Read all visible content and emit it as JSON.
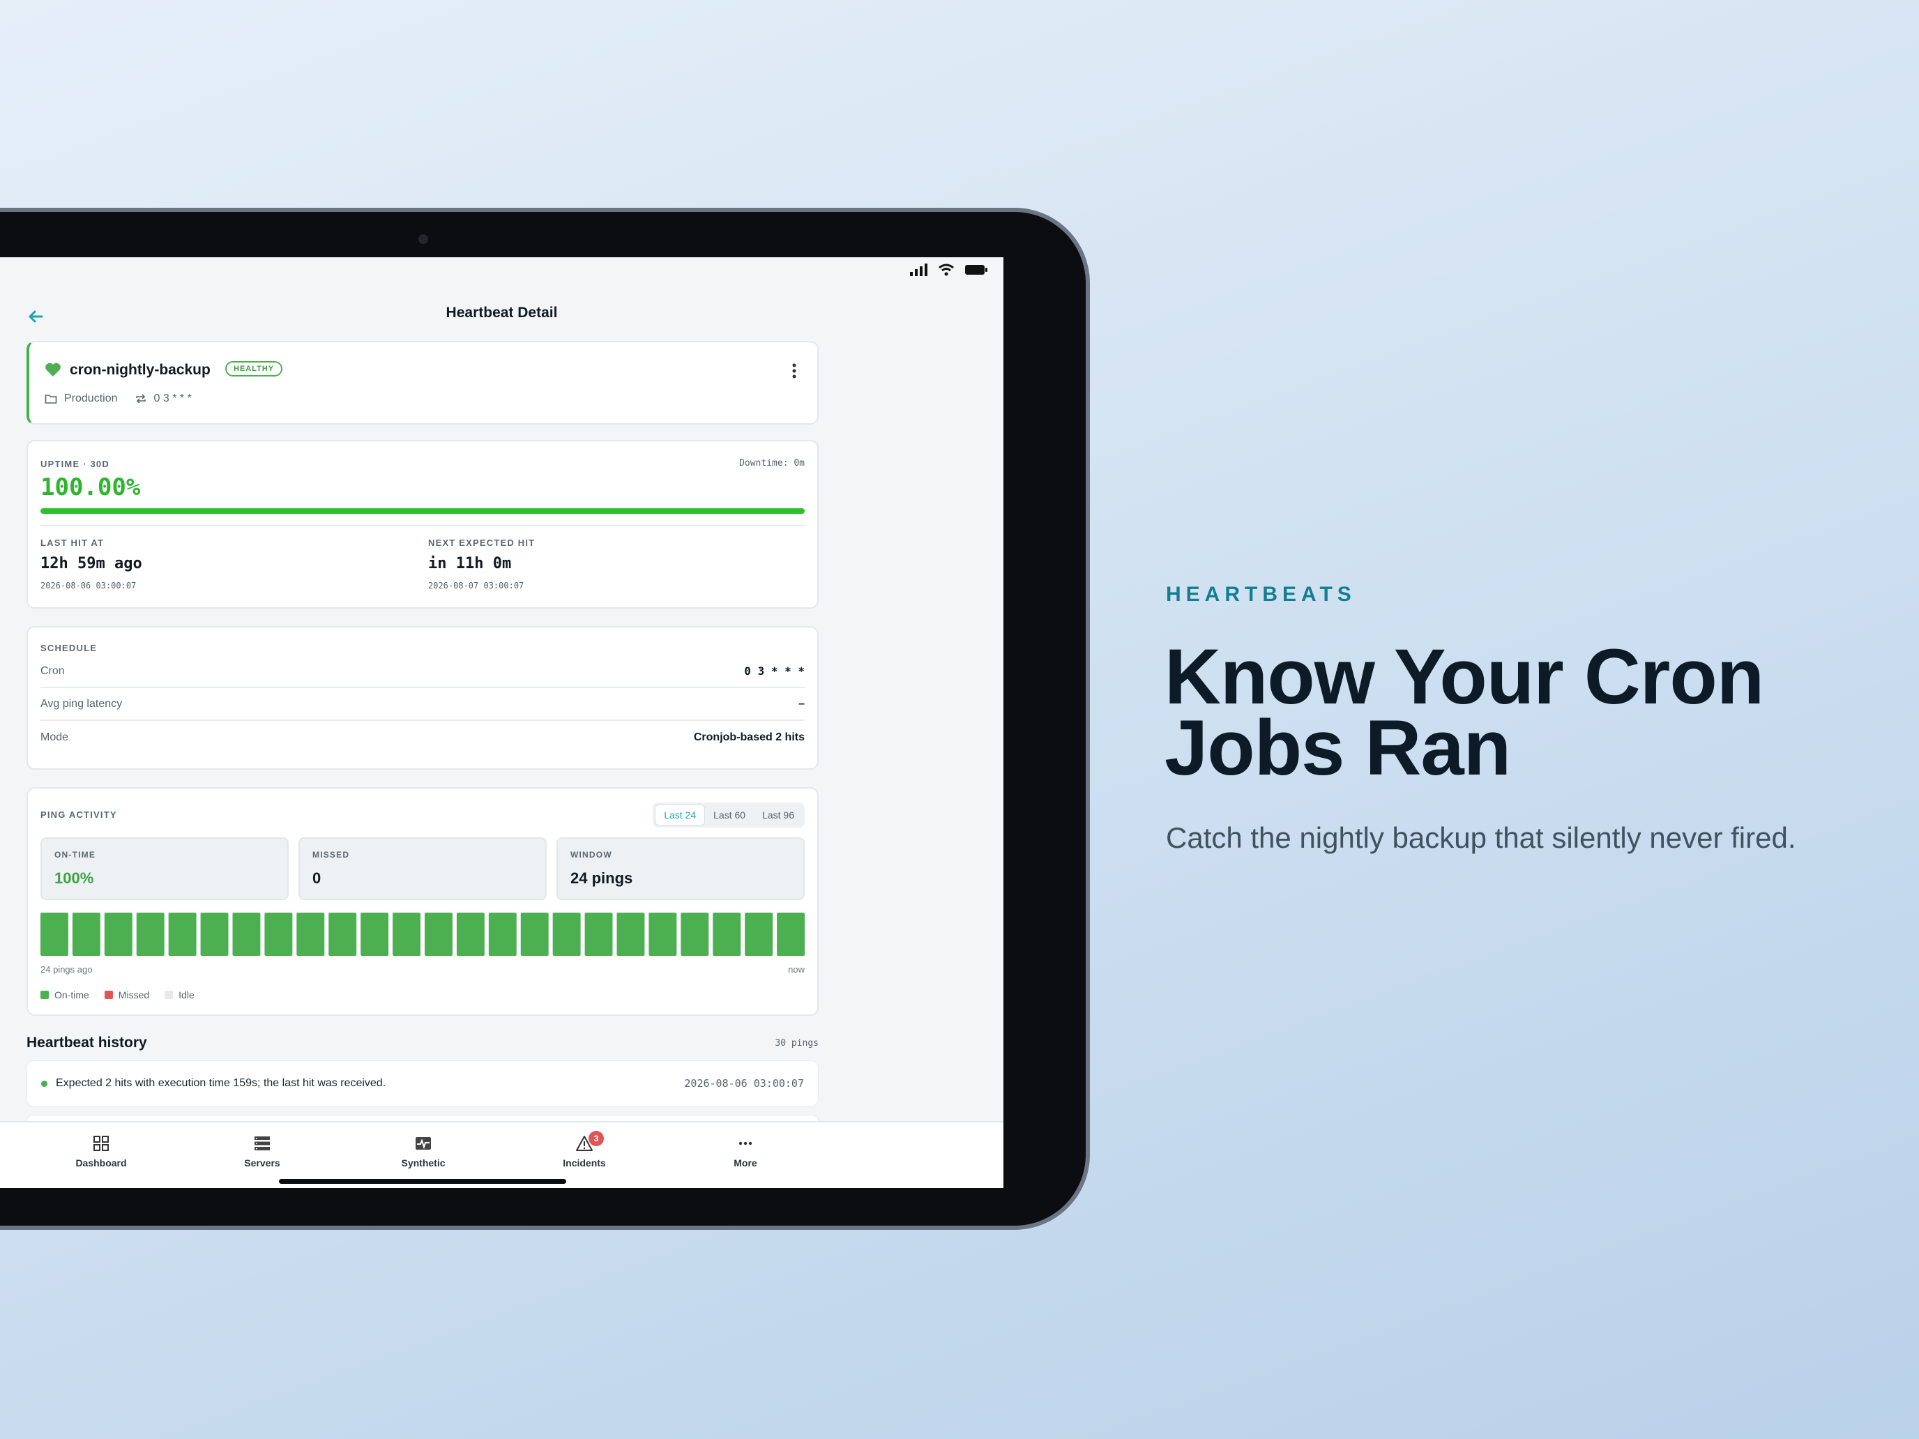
{
  "marketing": {
    "kicker": "HEARTBEATS",
    "headline": "Know Your Cron Jobs Ran",
    "subtitle": "Catch the nightly backup that silently never fired."
  },
  "header": {
    "title": "Heartbeat Detail"
  },
  "monitor": {
    "name": "cron-nightly-backup",
    "status": "HEALTHY",
    "project": "Production",
    "cron_short": "0 3 * * *"
  },
  "uptime": {
    "label": "UPTIME · 30D",
    "downtime": "Downtime: 0m",
    "percent_text": "100.00%",
    "percent_value": 100,
    "last_hit_label": "LAST HIT AT",
    "last_hit": "12h 59m ago",
    "last_hit_ts": "2026-08-06 03:00:07",
    "next_hit_label": "NEXT EXPECTED HIT",
    "next_hit": "in 11h 0m",
    "next_hit_ts": "2026-08-07 03:00:07"
  },
  "schedule": {
    "label": "SCHEDULE",
    "rows": [
      {
        "key": "Cron",
        "value": "0 3 * * *"
      },
      {
        "key": "Avg ping latency",
        "value": "–"
      },
      {
        "key": "Mode",
        "value": "Cronjob-based 2 hits"
      }
    ]
  },
  "ping_activity": {
    "label": "PING ACTIVITY",
    "ranges": [
      "Last 24",
      "Last 60",
      "Last 96"
    ],
    "active_range": 0,
    "stats": [
      {
        "label": "ON-TIME",
        "value": "100%"
      },
      {
        "label": "MISSED",
        "value": "0"
      },
      {
        "label": "WINDOW",
        "value": "24 pings"
      }
    ],
    "pings": [
      "ok",
      "ok",
      "ok",
      "ok",
      "ok",
      "ok",
      "ok",
      "ok",
      "ok",
      "ok",
      "ok",
      "ok",
      "ok",
      "ok",
      "ok",
      "ok",
      "ok",
      "ok",
      "ok",
      "ok",
      "ok",
      "ok",
      "ok",
      "ok"
    ],
    "axis_start": "24 pings ago",
    "axis_end": "now",
    "legend": [
      {
        "label": "On-time",
        "color": "#4caf50"
      },
      {
        "label": "Missed",
        "color": "#e05555"
      },
      {
        "label": "Idle",
        "color": "#e6eaee"
      }
    ]
  },
  "history": {
    "title": "Heartbeat history",
    "count": "30 pings",
    "items": [
      {
        "message": "Expected 2 hits with execution time 159s; the last hit was received.",
        "timestamp": "2026-08-06 03:00:07"
      }
    ]
  },
  "tabs": [
    {
      "label": "Dashboard",
      "icon": "grid-icon"
    },
    {
      "label": "Servers",
      "icon": "server-icon"
    },
    {
      "label": "Synthetic",
      "icon": "pulse-icon"
    },
    {
      "label": "Incidents",
      "icon": "warning-icon",
      "badge": "3"
    },
    {
      "label": "More",
      "icon": "more-icon"
    }
  ],
  "colors": {
    "accent": "#1aa5b5",
    "ok": "#4caf50",
    "missed": "#e05555"
  }
}
